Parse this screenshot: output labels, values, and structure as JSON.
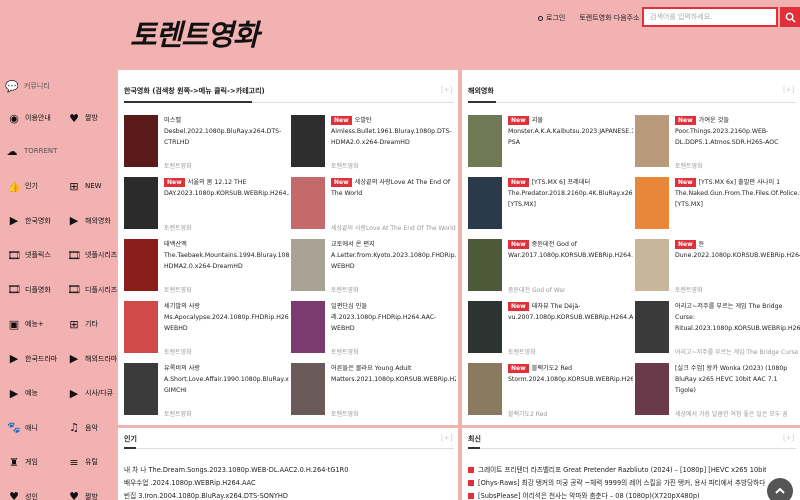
{
  "header": {
    "logo": "토렌트영화",
    "login": "로그인",
    "bookmark": "토렌트영화 다음주소",
    "search_placeholder": "검색어를 입력하세요."
  },
  "sidebar": {
    "community_label": "커뮤니티",
    "torrent_label": "TORRENT",
    "community": [
      {
        "label": "이용안내",
        "icon": "user-circle-icon"
      },
      {
        "label": "짤방",
        "icon": "heart-icon"
      }
    ],
    "items": [
      {
        "label": "인기",
        "icon": "thumbs-up-icon"
      },
      {
        "label": "NEW",
        "icon": "plus-square-icon"
      },
      {
        "label": "한국영화",
        "icon": "play-circle-icon"
      },
      {
        "label": "해외영화",
        "icon": "play-circle-icon"
      },
      {
        "label": "넷플릭스",
        "icon": "film-icon"
      },
      {
        "label": "넷플시리즈",
        "icon": "film-icon"
      },
      {
        "label": "디플영화",
        "icon": "film-icon"
      },
      {
        "label": "디플시리즈",
        "icon": "film-icon"
      },
      {
        "label": "예능+",
        "icon": "tv-plus-icon"
      },
      {
        "label": "기타",
        "icon": "plus-square-icon"
      },
      {
        "label": "한국드라마",
        "icon": "play-icon"
      },
      {
        "label": "해외드라마",
        "icon": "play-icon"
      },
      {
        "label": "예능",
        "icon": "play-icon"
      },
      {
        "label": "시사/다큐",
        "icon": "play-icon"
      },
      {
        "label": "애니",
        "icon": "paw-icon"
      },
      {
        "label": "음악",
        "icon": "music-icon"
      },
      {
        "label": "게임",
        "icon": "castle-icon"
      },
      {
        "label": "유틸",
        "icon": "database-icon"
      },
      {
        "label": "성인",
        "icon": "heart-icon"
      },
      {
        "label": "짤방",
        "icon": "heart-icon"
      }
    ]
  },
  "korean": {
    "title": "한국영화 (검색창 원쪽->메뉴 클릭->카테고리)",
    "more": "[+]",
    "left": [
      {
        "new": false,
        "name": "미스벨",
        "file": "Desbel.2022.1080p.BluRay.x264.DTS-CTRLHD",
        "sub": "토렌트영화",
        "poster": "#5a1a1a"
      },
      {
        "new": true,
        "name": "서울의 봄 12.12 THE DAY.2023.1080p.KORSUB.WEBRip.H264.AAC",
        "file": "",
        "sub": "토렌트영화",
        "poster": "#2b2b2b"
      },
      {
        "new": false,
        "name": "태백산맥",
        "file": "The.Taebaek.Mountains.1994.Bluray.1080p.DTS-HDMA2.0.x264-DreamHD",
        "sub": "토렌트영화",
        "poster": "#8a1e1a"
      },
      {
        "new": false,
        "name": "세기말의 사랑",
        "file": "Ms.Apocalypse.2024.1080p.FHDRip.H264.AAC-WEBHD",
        "sub": "토렌트영화",
        "poster": "#d14a4a"
      },
      {
        "new": false,
        "name": "유록비의 사랑",
        "file": "A.Short.Love.Affair.1990.1080p.BluRay.x264-GIMCHI",
        "sub": "토렌트영화",
        "poster": "#3b3b3b"
      }
    ],
    "right": [
      {
        "new": true,
        "name": "오발탄",
        "file": "Aimless.Bullet.1961.Bluray.1080p.DTS-HDMA2.0.x264-DreamHD",
        "sub": "토렌트영화",
        "poster": "#2e2e2e"
      },
      {
        "new": true,
        "name": "세상끝의 사랑Love At The End Of The World",
        "file": "",
        "sub": "세상끝의 사랑Love At The End Of The World",
        "poster": "#c56a6a"
      },
      {
        "new": false,
        "name": "교토에서 온 편지",
        "file": "A.Letter.from.Kyoto.2023.1080p.FHDRip.H264.AAC-WEBHD",
        "sub": "토렌트영화",
        "poster": "#a9a295"
      },
      {
        "new": false,
        "name": "일편단심 민들",
        "file": "레.2023.1080p.FHDRip.H264.AAC-WEBHD",
        "sub": "토렌트영화",
        "poster": "#7c3b6e"
      },
      {
        "new": false,
        "name": "어른들은 몰라요 Young Adult Matters.2021.1080p.KORSUB.WEBRip.H264.AAC",
        "file": "",
        "sub": "토렌트영화",
        "poster": "#6a5a5a"
      }
    ]
  },
  "foreign": {
    "title": "해외영화",
    "more": "[+]",
    "left": [
      {
        "new": true,
        "name": "괴물",
        "file": "Monster.A.K.A.Kaibutsu.2023.JAPANESE.1080p.BluRay.x264.DTS-PSA",
        "sub": "",
        "poster": "#6f7a54"
      },
      {
        "new": true,
        "name": "[YTS.MX 6] 프레데터",
        "file": "The.Predator.2018.2160p.4K.BluRay.x265.10bit.AAC5.1-[YTS.MX]",
        "sub": "",
        "poster": "#2b3a4a"
      },
      {
        "new": true,
        "name": "중듄데전 God of War.2017.1080p.KORSUB.WEBRip.H264.AAC",
        "file": "",
        "sub": "중듄데전 God of War",
        "poster": "#4d5a3a"
      },
      {
        "new": true,
        "name": "데자뷰 The Déjà-vu.2007.1080p.KORSUB.WEBRip.H264.AAC",
        "file": "",
        "sub": "토렌트영화",
        "poster": "#2d3330"
      },
      {
        "new": true,
        "name": "블랙기도2 Red Storm.2024.1080p.KORSUB.WEBRip.H264.AAC",
        "file": "",
        "sub": "블랙기도2 Red",
        "poster": "#8a7a60"
      }
    ],
    "right": [
      {
        "new": true,
        "name": "가여운 것들",
        "file": "Poor.Things.2023.2160p.WEB-DL.DDP5.1.Atmos.SDR.H265-AOC",
        "sub": "토렌트영화",
        "poster": "#b89a7a"
      },
      {
        "new": true,
        "name": "[YTS.MX 6x] 출말판 사나이 1",
        "file": "The.Naked.Gun.From.The.Files.Of.Police.Squad.1988.1080p.BluRay.x264-[YTS.MX]",
        "sub": "",
        "poster": "#e8873a"
      },
      {
        "new": true,
        "name": "듄",
        "file": "Dune.2022.1080p.KORSUB.WEBRip.H264.AAC",
        "sub": "토렌트영화",
        "poster": "#c9b59a"
      },
      {
        "new": false,
        "name": "어리고~저주를 부르는 게임 The Bridge Curse: Ritual.2023.1080p.KORSUB.WEBRip.H264.AAC",
        "file": "",
        "sub": "어리고~저주를 부르는 게임 The Bridge Curse",
        "poster": "#3a3a3a"
      },
      {
        "new": false,
        "name": "[실크 수업] 왕카 Wonka (2023) (1080p BluRay x265 HEVC 10bit AAC 7.1 Tigole)",
        "file": "",
        "sub": "세상에서 가장 달콤한 여정 좋은 일은 모두 꿈",
        "poster": "#6a3a4a"
      }
    ]
  },
  "popular": {
    "title": "인기",
    "more": "[+]",
    "lines": [
      "내 차 나 The.Dream.Songs.2023.1080p.WEB-DL.AAC2.0.H.264-tG1R0",
      "배우수업 .2024.1080p.WEBRip.H264.AAC",
      "빈집 3.Iron.2004.1080p.BluRay.x264.DTS-SONYHD"
    ]
  },
  "latest": {
    "title": "최신",
    "more": "[+]",
    "lines": [
      "그레이트 프리텐더 라즈벨리포 Great Pretender Razbliuto (2024) – [1080p] [HEVC x265 10bit] [Multi-Subs] [",
      "[Ohys-Raws] 최강 탱커의 미궁 공략 ~체력 9999의 레어 스킬을 가진 탱커, 용사 파티에서 추방당하다~ –",
      "[SubsPlease] 어리석은 천사는 악마와 춤춘다 – 08 (1080p)(X720pX480p)"
    ]
  }
}
